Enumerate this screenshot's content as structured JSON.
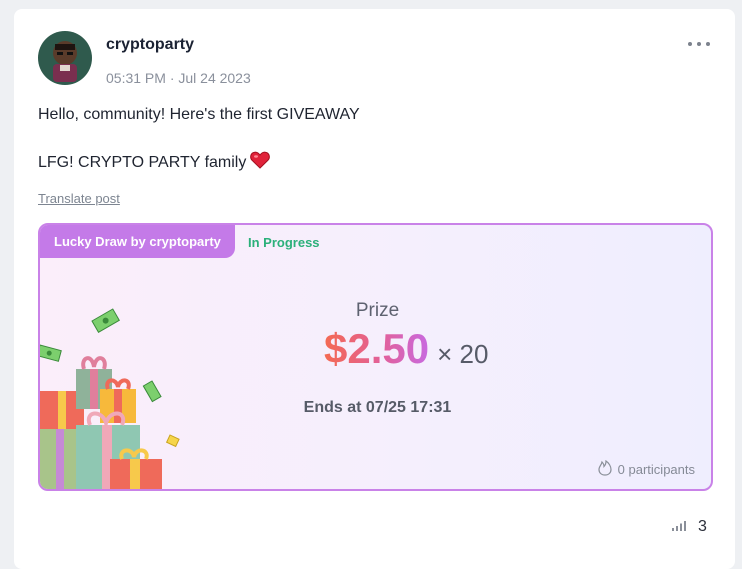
{
  "post": {
    "author": "cryptoparty",
    "timestamp": "05:31 PM · Jul 24 2023",
    "line1": "Hello, community! Here's the first GIVEAWAY",
    "line2": "LFG! CRYPTO PARTY family",
    "emoji": "❤️",
    "translate_label": "Translate post"
  },
  "lucky_draw": {
    "tag": "Lucky Draw by cryptoparty",
    "status": "In Progress",
    "prize_label": "Prize",
    "prize_amount": "$2.50",
    "prize_multiplier": "× 20",
    "ends_text": "Ends at 07/25 17:31",
    "participants": "0 participants"
  },
  "stats": {
    "views": "3"
  },
  "icons": {
    "more": "more-horizontal-icon",
    "fire": "fire-icon",
    "views": "bar-chart-icon"
  },
  "colors": {
    "status_green": "#2bb07a",
    "tag_purple": "#c47ae8",
    "border_purple": "#c982e8"
  }
}
